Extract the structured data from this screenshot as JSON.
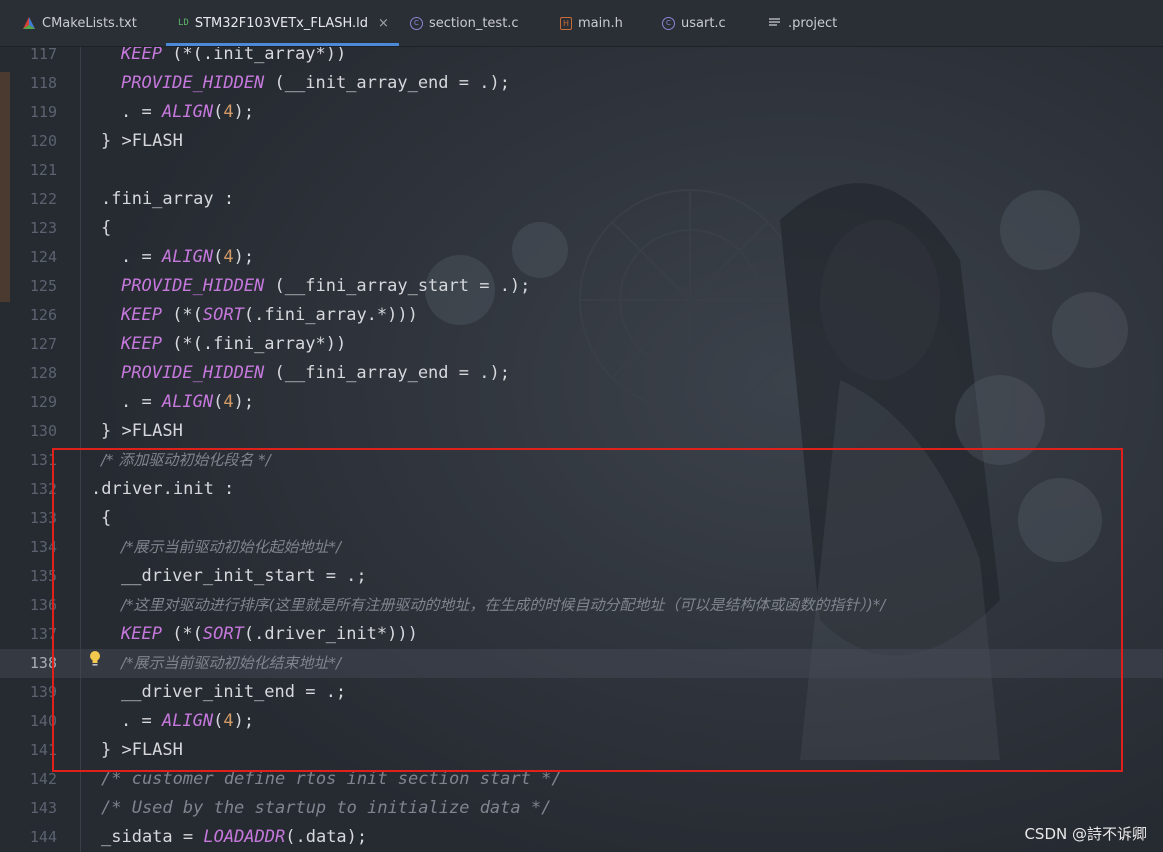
{
  "tabs": [
    {
      "label": "CMakeLists.txt",
      "icon": "cmake-icon",
      "active": false
    },
    {
      "label": "STM32F103VETx_FLASH.ld",
      "icon": "ld-file-icon",
      "active": true
    },
    {
      "label": "section_test.c",
      "icon": "c-file-icon",
      "active": false
    },
    {
      "label": "main.h",
      "icon": "h-file-icon",
      "active": false
    },
    {
      "label": "usart.c",
      "icon": "c-file-icon",
      "active": false
    },
    {
      "label": ".project",
      "icon": "text-file-icon",
      "active": false
    }
  ],
  "active_tab_close": "×",
  "colors": {
    "accent": "#4b8ad9",
    "highlight_box": "#e0201b",
    "keyword": "#c679dd",
    "number": "#d19a66",
    "comment": "#7f848e"
  },
  "current_line": 138,
  "lines": [
    {
      "n": "117",
      "t": "KEEP (*(.init_array*))"
    },
    {
      "n": "118",
      "t": "PROVIDE_HIDDEN (__init_array_end = .);"
    },
    {
      "n": "119",
      "t": ". = ALIGN(4);"
    },
    {
      "n": "120",
      "t": "} >FLASH"
    },
    {
      "n": "121",
      "t": ""
    },
    {
      "n": "122",
      "t": ".fini_array :"
    },
    {
      "n": "123",
      "t": "{"
    },
    {
      "n": "124",
      "t": ". = ALIGN(4);"
    },
    {
      "n": "125",
      "t": "PROVIDE_HIDDEN (__fini_array_start = .);"
    },
    {
      "n": "126",
      "t": "KEEP (*(SORT(.fini_array.*)))"
    },
    {
      "n": "127",
      "t": "KEEP (*(.fini_array*))"
    },
    {
      "n": "128",
      "t": "PROVIDE_HIDDEN (__fini_array_end = .);"
    },
    {
      "n": "129",
      "t": ". = ALIGN(4);"
    },
    {
      "n": "130",
      "t": "} >FLASH"
    },
    {
      "n": "131",
      "t": "/* 添加驱动初始化段名 */"
    },
    {
      "n": "132",
      "t": ".driver.init :"
    },
    {
      "n": "133",
      "t": "{"
    },
    {
      "n": "134",
      "t": "/*展示当前驱动初始化起始地址*/"
    },
    {
      "n": "135",
      "t": "__driver_init_start = .;"
    },
    {
      "n": "136",
      "t": "/*这里对驱动进行排序(这里就是所有注册驱动的地址，在生成的时候自动分配地址（可以是结构体或函数的指针）)*/"
    },
    {
      "n": "137",
      "t": "KEEP (*(SORT(.driver_init*)))"
    },
    {
      "n": "138",
      "t": "/*展示当前驱动初始化结束地址*/"
    },
    {
      "n": "139",
      "t": "__driver_init_end = .;"
    },
    {
      "n": "140",
      "t": ". = ALIGN(4);"
    },
    {
      "n": "141",
      "t": "} >FLASH"
    },
    {
      "n": "142",
      "t": "/* customer define rtos init section start */"
    },
    {
      "n": "143",
      "t": "/* Used by the startup to initialize data */"
    },
    {
      "n": "144",
      "t": "_sidata = LOADADDR(.data);"
    }
  ],
  "watermark": "CSDN @詩不诉卿"
}
